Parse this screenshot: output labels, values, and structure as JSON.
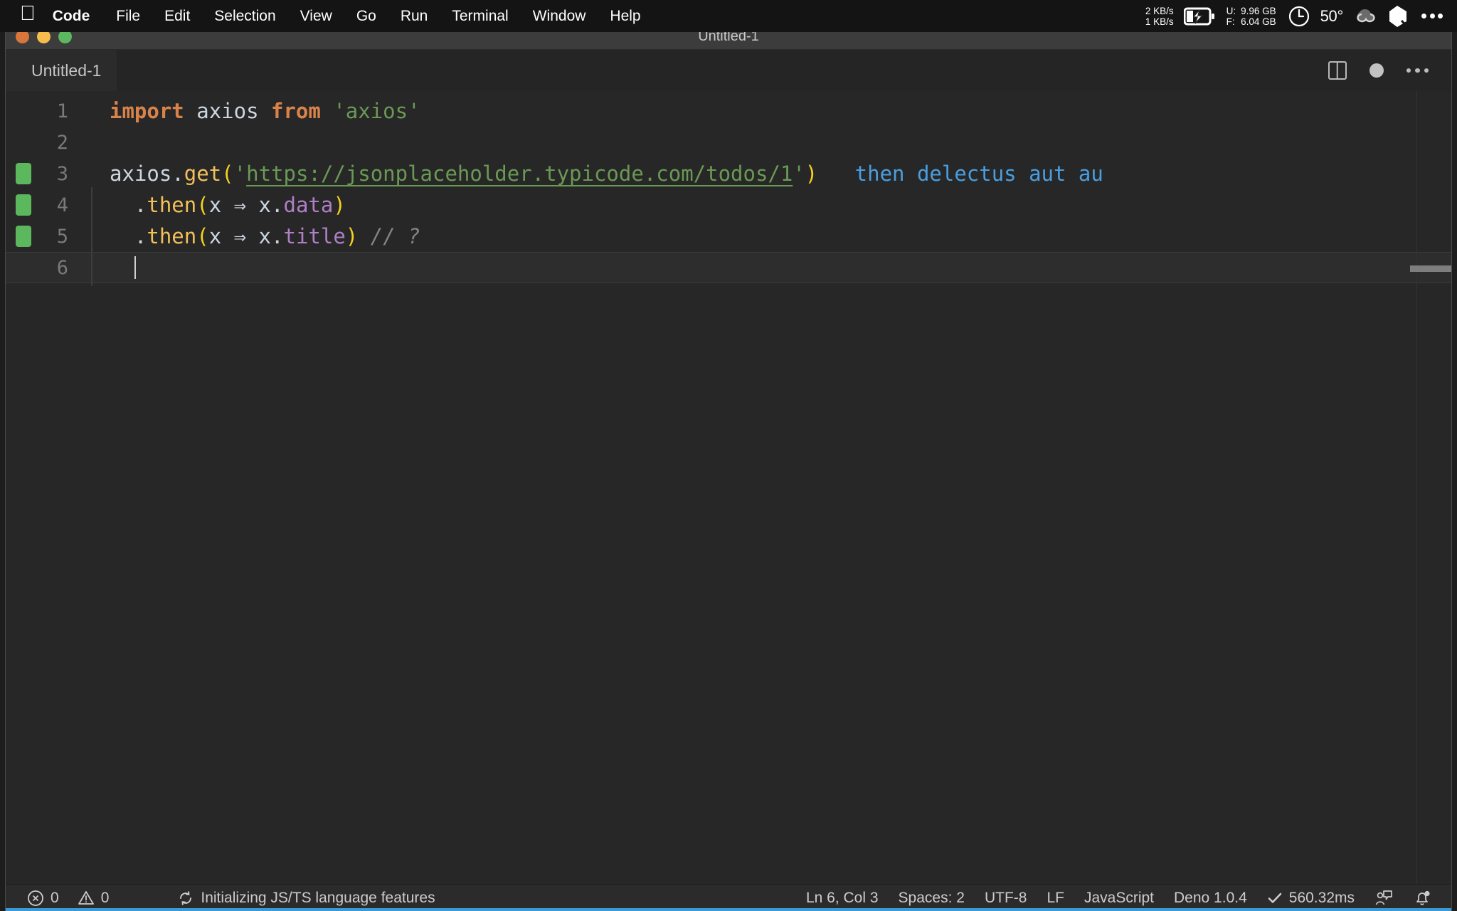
{
  "menubar": {
    "apple_icon": "apple-logo-icon",
    "items": [
      {
        "label": "Code",
        "bold": true
      },
      {
        "label": "File",
        "bold": false
      },
      {
        "label": "Edit",
        "bold": false
      },
      {
        "label": "Selection",
        "bold": false
      },
      {
        "label": "View",
        "bold": false
      },
      {
        "label": "Go",
        "bold": false
      },
      {
        "label": "Run",
        "bold": false
      },
      {
        "label": "Terminal",
        "bold": false
      },
      {
        "label": "Window",
        "bold": false
      },
      {
        "label": "Help",
        "bold": false
      }
    ],
    "status": {
      "net_down": "2 KB/s",
      "net_up": "1 KB/s",
      "battery_icon": "battery-charging-icon",
      "mem_used_label": "U:",
      "mem_free_label": "F:",
      "mem_used_value": "9.96 GB",
      "mem_free_value": "6.04 GB",
      "clock_icon": "clock-icon",
      "temperature": "50°",
      "cloud_icon": "cloud-sync-icon",
      "shape_icon": "pentagon-icon",
      "more_icon": "more-dots-icon"
    }
  },
  "window": {
    "title": "Untitled-1",
    "traffic_lights": [
      "close-button",
      "minimize-button",
      "maximize-button"
    ]
  },
  "tabbar": {
    "tabs": [
      {
        "label": "Untitled-1",
        "active": true,
        "dirty": true
      }
    ],
    "actions": [
      {
        "name": "split-editor-icon"
      },
      {
        "name": "unsaved-dot-icon"
      },
      {
        "name": "more-actions-icon"
      }
    ]
  },
  "editor": {
    "lines": [
      {
        "number": "1",
        "gutter_mark": false,
        "indent_guide": false,
        "current": false,
        "tokens": [
          {
            "text": "import",
            "cls": "t-kw"
          },
          {
            "text": " ",
            "cls": "t-plain"
          },
          {
            "text": "axios",
            "cls": "t-plain"
          },
          {
            "text": " ",
            "cls": "t-plain"
          },
          {
            "text": "from",
            "cls": "t-kw"
          },
          {
            "text": " ",
            "cls": "t-plain"
          },
          {
            "text": "'axios'",
            "cls": "t-string"
          }
        ]
      },
      {
        "number": "2",
        "gutter_mark": false,
        "indent_guide": false,
        "current": false,
        "tokens": []
      },
      {
        "number": "3",
        "gutter_mark": true,
        "indent_guide": false,
        "current": false,
        "tokens": [
          {
            "text": "axios",
            "cls": "t-plain"
          },
          {
            "text": ".",
            "cls": "t-plain"
          },
          {
            "text": "get",
            "cls": "t-fn"
          },
          {
            "text": "(",
            "cls": "t-paren"
          },
          {
            "text": "'",
            "cls": "t-string"
          },
          {
            "text": "https://jsonplaceholder.typicode.com/todos/1",
            "cls": "t-string-link"
          },
          {
            "text": "'",
            "cls": "t-string"
          },
          {
            "text": ")",
            "cls": "t-paren"
          },
          {
            "text": "   then delectus aut au",
            "cls": "t-ghost"
          }
        ]
      },
      {
        "number": "4",
        "gutter_mark": true,
        "indent_guide": true,
        "current": false,
        "tokens": [
          {
            "text": "  ",
            "cls": "t-plain"
          },
          {
            "text": ".",
            "cls": "t-plain"
          },
          {
            "text": "then",
            "cls": "t-fn"
          },
          {
            "text": "(",
            "cls": "t-paren"
          },
          {
            "text": "x ",
            "cls": "t-plain"
          },
          {
            "text": "⇒",
            "cls": "t-plain"
          },
          {
            "text": " x",
            "cls": "t-plain"
          },
          {
            "text": ".",
            "cls": "t-plain"
          },
          {
            "text": "data",
            "cls": "t-prop"
          },
          {
            "text": ")",
            "cls": "t-paren"
          }
        ]
      },
      {
        "number": "5",
        "gutter_mark": true,
        "indent_guide": true,
        "current": false,
        "tokens": [
          {
            "text": "  ",
            "cls": "t-plain"
          },
          {
            "text": ".",
            "cls": "t-plain"
          },
          {
            "text": "then",
            "cls": "t-fn"
          },
          {
            "text": "(",
            "cls": "t-paren"
          },
          {
            "text": "x ",
            "cls": "t-plain"
          },
          {
            "text": "⇒",
            "cls": "t-plain"
          },
          {
            "text": " x",
            "cls": "t-plain"
          },
          {
            "text": ".",
            "cls": "t-plain"
          },
          {
            "text": "title",
            "cls": "t-prop"
          },
          {
            "text": ")",
            "cls": "t-paren"
          },
          {
            "text": " ",
            "cls": "t-plain"
          },
          {
            "text": "// ?",
            "cls": "t-comment"
          }
        ]
      },
      {
        "number": "6",
        "gutter_mark": false,
        "indent_guide": true,
        "current": true,
        "tokens": [
          {
            "text": "  ",
            "cls": "t-plain"
          }
        ]
      }
    ]
  },
  "statusbar": {
    "errors_icon": "error-circle-icon",
    "errors_count": "0",
    "warnings_icon": "warning-triangle-icon",
    "warnings_count": "0",
    "sync_icon": "sync-spinner-icon",
    "task_text": "Initializing JS/TS language features",
    "cursor_position": "Ln 6, Col 3",
    "indentation": "Spaces: 2",
    "encoding": "UTF-8",
    "eol": "LF",
    "language": "JavaScript",
    "runtime": "Deno 1.0.4",
    "check_icon": "check-icon",
    "timing": "560.32ms",
    "feedback_icon": "feedback-person-icon",
    "bell_icon": "bell-dot-icon"
  },
  "colors": {
    "accent": "#3a9ad9",
    "editor_bg": "#272727",
    "statusbar_bg": "#2b2b2b",
    "git_added": "#5cb85c",
    "ghost_text": "#4a9ee0"
  }
}
